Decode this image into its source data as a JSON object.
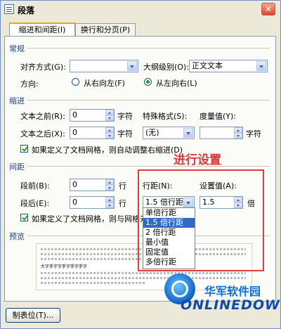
{
  "dialog": {
    "title": "段落",
    "close_glyph": "✕"
  },
  "tabs": [
    {
      "label": "缩进和间距(I)"
    },
    {
      "label": "换行和分页(P)"
    }
  ],
  "general": {
    "section": "常规",
    "align_label": "对齐方式(G):",
    "align_value": "",
    "outline_label": "大纲级别(O):",
    "outline_value": "正文文本",
    "direction_label": "方向:",
    "rtl_label": "从右向左(F)",
    "ltr_label": "从左向右(L)",
    "direction_selected": "ltr"
  },
  "indent": {
    "section": "缩进",
    "before_label": "文本之前(R):",
    "before_value": "0",
    "after_label": "文本之后(X):",
    "after_value": "0",
    "unit": "字符",
    "special_label": "特殊格式(S):",
    "special_value": "(无)",
    "measure_label": "度量值(Y):",
    "measure_value": "",
    "measure_unit": "字符",
    "grid_check_label": "如果定义了文档网格，则自动调整右缩进(D)",
    "grid_checked": true
  },
  "spacing": {
    "section": "间距",
    "before_label": "段前(B):",
    "before_value": "0",
    "after_label": "段后(E):",
    "after_value": "0",
    "unit": "行",
    "line_label": "行距(N):",
    "line_value": "1.5 倍行距",
    "setting_label": "设置值(A):",
    "setting_value": "1.5",
    "setting_unit": "倍",
    "grid_check_label": "如果定义了文档网格，则与网格对",
    "grid_checked": true,
    "line_options": [
      "单倍行距",
      "1.5 倍行距",
      "2 倍行距",
      "最小值",
      "固定值",
      "多倍行距"
    ],
    "line_selected_index": 1
  },
  "annotation": "进行设置",
  "preview": {
    "section": "预览",
    "sample_text": "大字手字字手字手字手字"
  },
  "tabstop_button": "制表位(T)...",
  "watermark": {
    "top": "华军软件园",
    "bottom": "ONLINEDOWN.NET"
  }
}
